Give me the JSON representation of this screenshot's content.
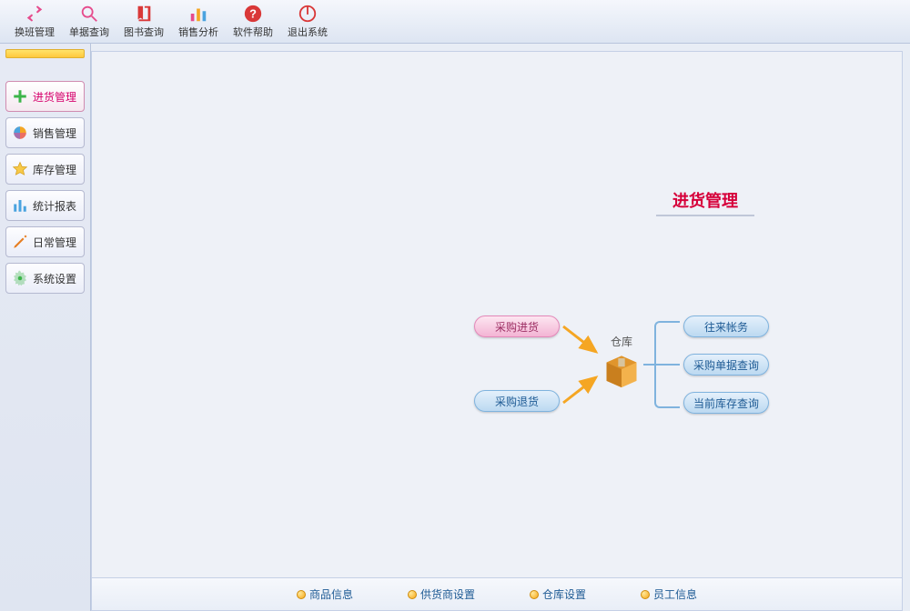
{
  "toolbar": [
    {
      "icon": "swap",
      "label": "换班管理"
    },
    {
      "icon": "search",
      "label": "单据查询"
    },
    {
      "icon": "book",
      "label": "图书查询"
    },
    {
      "icon": "chart",
      "label": "销售分析"
    },
    {
      "icon": "help",
      "label": "软件帮助"
    },
    {
      "icon": "exit",
      "label": "退出系统"
    }
  ],
  "sidebar": [
    {
      "icon": "plus",
      "label": "进货管理",
      "active": true
    },
    {
      "icon": "ball",
      "label": "销售管理"
    },
    {
      "icon": "star",
      "label": "库存管理"
    },
    {
      "icon": "bars",
      "label": "统计报表"
    },
    {
      "icon": "pencil",
      "label": "日常管理"
    },
    {
      "icon": "gear",
      "label": "系统设置"
    }
  ],
  "content": {
    "title": "进货管理",
    "warehouse_label": "仓库",
    "bubbles": {
      "b1": "采购进货",
      "b2": "采购退货",
      "b3": "往来帐务",
      "b4": "采购单据查询",
      "b5": "当前库存查询"
    }
  },
  "bottom_links": [
    "商品信息",
    "供货商设置",
    "仓库设置",
    "员工信息"
  ]
}
